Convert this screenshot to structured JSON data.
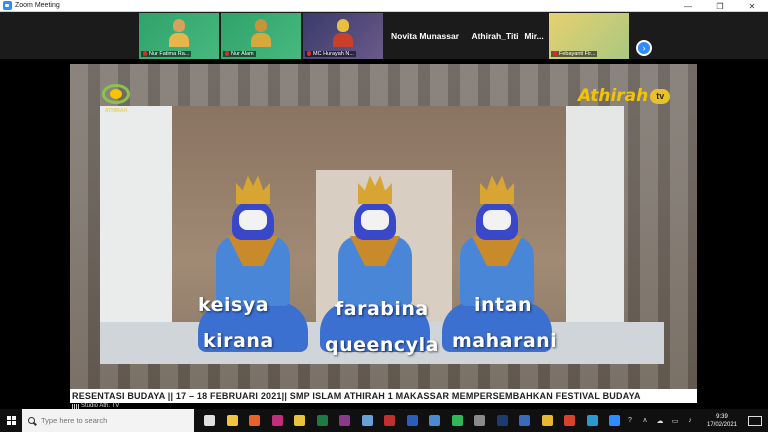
{
  "window": {
    "title": "Zoom Meeting",
    "controls": [
      "—",
      "❐",
      "✕"
    ]
  },
  "gallery": {
    "participants": [
      {
        "name": "Nur Fatima Ra...",
        "kind": "video"
      },
      {
        "name": "Nur Alam",
        "kind": "video"
      },
      {
        "name": "MC Hurayah N...",
        "kind": "video"
      },
      {
        "name": "Novita Munassar",
        "kind": "text"
      },
      {
        "name": "Athirah_Titi",
        "kind": "text"
      },
      {
        "name": "Mir...",
        "kind": "text"
      },
      {
        "name": "Febayanti Fir...",
        "kind": "video"
      }
    ],
    "next_label": "›"
  },
  "share": {
    "logo_left_text": "ATHIRAH",
    "logo_right_text": "Athirah",
    "logo_right_tv": "tv",
    "captions": [
      {
        "top": "keisya",
        "bottom": "kirana"
      },
      {
        "top": "farabina",
        "bottom": "queencyla"
      },
      {
        "top": "intan",
        "bottom": "maharani"
      }
    ],
    "ticker": "RESENTASI BUDAYA || 17 – 18 FEBRUARI 2021|| SMP ISLAM ATHIRAH 1 MAKASSAR MEMPERSEMBAHKAN FESTIVAL BUDAYA",
    "source_label": "Studio Ath. TV"
  },
  "taskbar": {
    "search_placeholder": "Type here to search",
    "apps": [
      {
        "name": "task-view",
        "color": "#e0e0e0"
      },
      {
        "name": "file-explorer",
        "color": "#f3c440"
      },
      {
        "name": "firefox",
        "color": "#e8622a"
      },
      {
        "name": "store",
        "color": "#c0307a"
      },
      {
        "name": "chrome-like",
        "color": "#e9c33a"
      },
      {
        "name": "excel",
        "color": "#1e7a44"
      },
      {
        "name": "winrar",
        "color": "#8a3a8a"
      },
      {
        "name": "notepad",
        "color": "#6aa0d8"
      },
      {
        "name": "app-red",
        "color": "#c03030"
      },
      {
        "name": "word",
        "color": "#2b5eb8"
      },
      {
        "name": "settings-app",
        "color": "#4a8ad0"
      },
      {
        "name": "whatsapp",
        "color": "#2fb85a"
      },
      {
        "name": "app-gray",
        "color": "#8a8a8a"
      },
      {
        "name": "photoshop",
        "color": "#1a3c70"
      },
      {
        "name": "app-blue",
        "color": "#3a6ab8"
      },
      {
        "name": "app-yellow",
        "color": "#e8b830"
      },
      {
        "name": "chrome",
        "color": "#d8442a"
      },
      {
        "name": "edge",
        "color": "#2a9ad0"
      },
      {
        "name": "zoom",
        "color": "#2d8cff"
      }
    ],
    "tray_icons": [
      "?",
      "ʌ",
      "☁",
      "▭",
      "♪"
    ],
    "time": "9:39",
    "date": "17/02/2021"
  }
}
